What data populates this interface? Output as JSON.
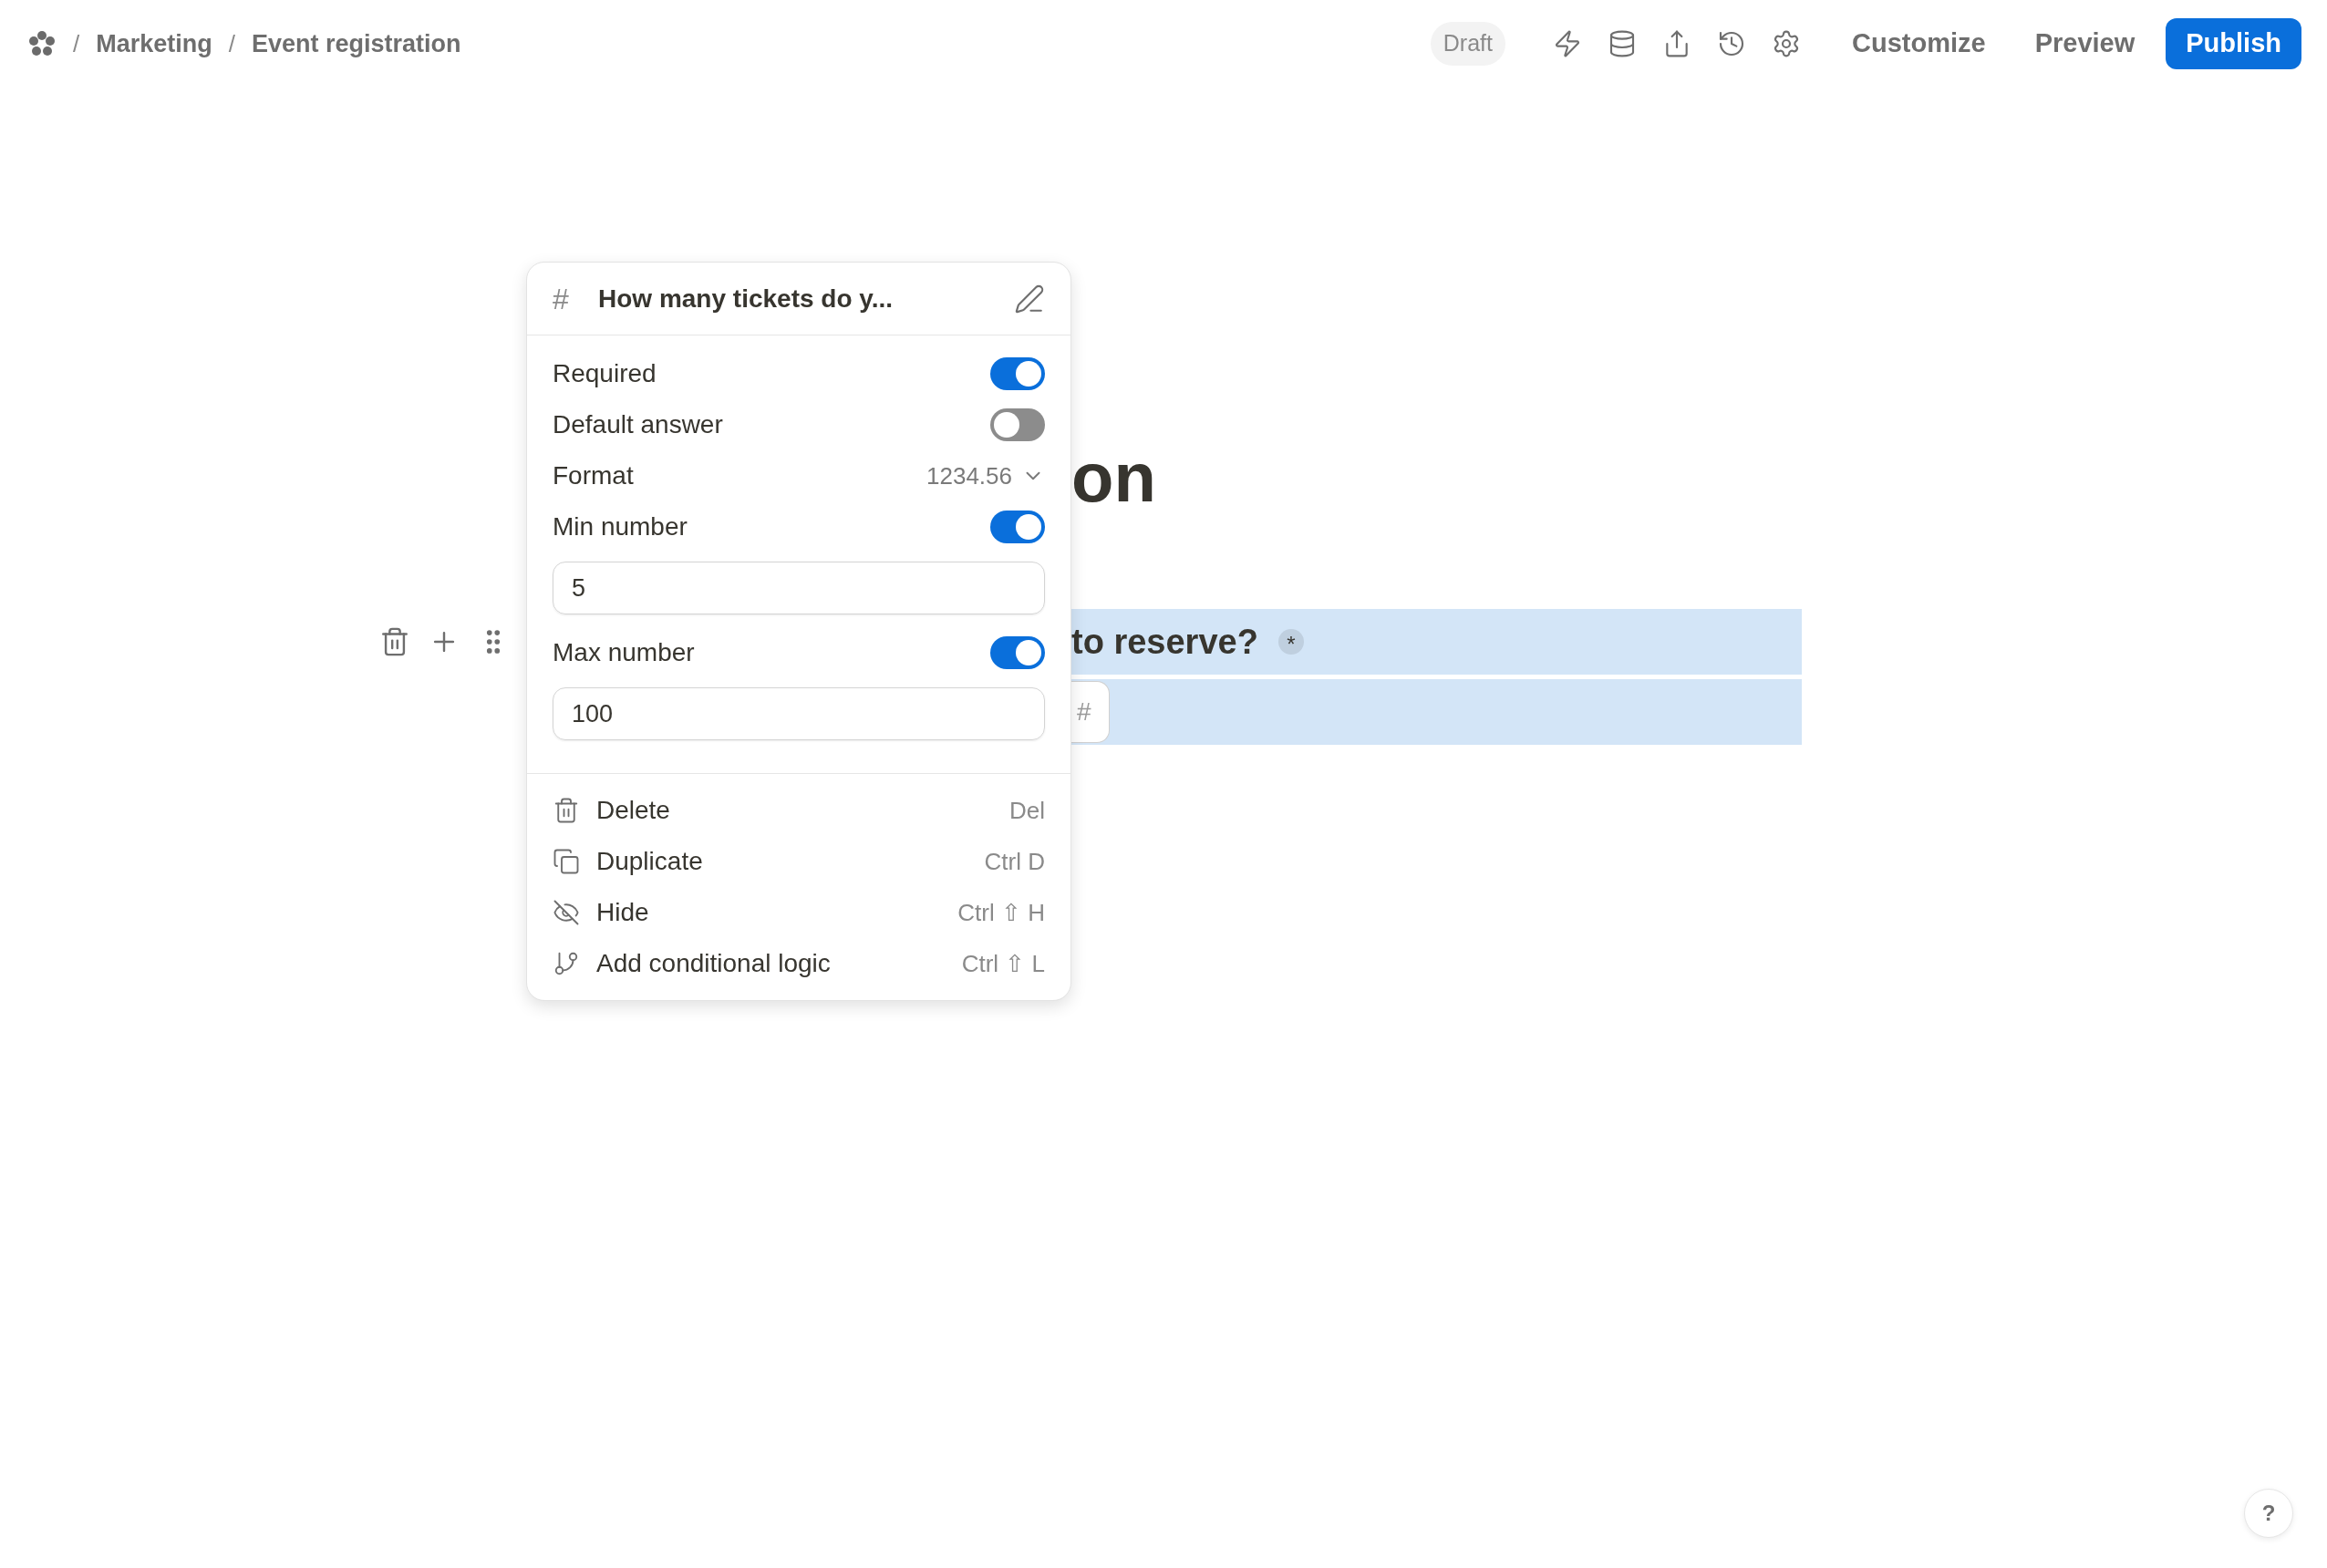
{
  "breadcrumb": [
    {
      "separator": "/",
      "label": "Marketing"
    },
    {
      "separator": "/",
      "label": "Event registration"
    }
  ],
  "header": {
    "status": "Draft",
    "actions": [
      "Customize",
      "Preview"
    ],
    "primary": "Publish"
  },
  "form": {
    "title_visible": "on",
    "question_visible": "to reserve?",
    "required_mark": "*",
    "input_symbol": "#"
  },
  "popover": {
    "symbol": "#",
    "title": "How many tickets do y...",
    "settings": [
      {
        "kind": "toggle",
        "label": "Required",
        "on": true
      },
      {
        "kind": "toggle",
        "label": "Default answer",
        "on": false
      },
      {
        "kind": "select",
        "label": "Format",
        "value": "1234.56"
      },
      {
        "kind": "toggle",
        "label": "Min number",
        "on": true,
        "input": "5"
      },
      {
        "kind": "toggle",
        "label": "Max number",
        "on": true,
        "input": "100"
      }
    ],
    "menu": [
      {
        "label": "Delete",
        "shortcut": "Del"
      },
      {
        "label": "Duplicate",
        "shortcut": "Ctrl D"
      },
      {
        "label": "Hide",
        "shortcut": "Ctrl ⇧ H"
      },
      {
        "label": "Add conditional logic",
        "shortcut": "Ctrl ⇧ L"
      }
    ]
  },
  "help": "?"
}
